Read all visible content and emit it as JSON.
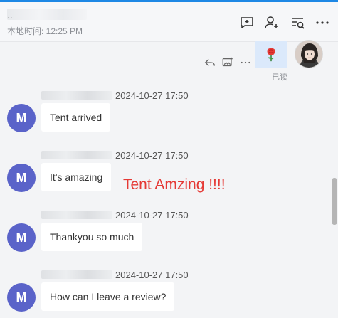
{
  "header": {
    "contact_name": "..",
    "local_time": "本地时间: 12:25 PM"
  },
  "sent": {
    "read_status": "已读"
  },
  "messages": [
    {
      "sender_initial": "M",
      "time": "2024-10-27 17:50",
      "text": "Tent arrived"
    },
    {
      "sender_initial": "M",
      "time": "2024-10-27 17:50",
      "text": "It's amazing"
    },
    {
      "sender_initial": "M",
      "time": "2024-10-27 17:50",
      "text": "Thankyou so much"
    },
    {
      "sender_initial": "M",
      "time": "2024-10-27 17:50",
      "text": "How can I leave a review?"
    }
  ],
  "annotation": "Tent Amzing !!!!",
  "colors": {
    "accent": "#1e88e5",
    "avatar": "#5a63c9",
    "annotation": "#e53935",
    "sent_bubble": "#dbe9fb"
  },
  "icons": {
    "header": [
      "add-comment-icon",
      "add-user-icon",
      "search-list-icon",
      "more-icon"
    ],
    "actions": [
      "reply-icon",
      "add-image-icon",
      "more-icon"
    ],
    "sent": "rose-emoji-icon"
  }
}
